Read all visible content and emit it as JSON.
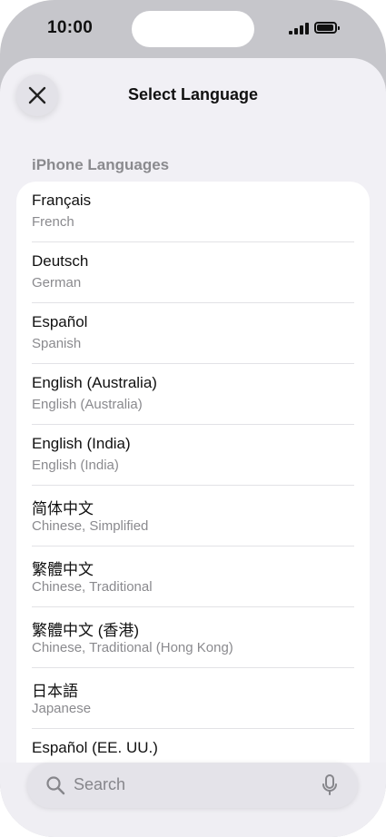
{
  "status_bar": {
    "time": "10:00"
  },
  "sheet": {
    "title": "Select Language",
    "close_icon": "close-icon"
  },
  "section": {
    "header": "iPhone Languages"
  },
  "languages": [
    {
      "name": "Français",
      "translation": "French"
    },
    {
      "name": "Deutsch",
      "translation": "German"
    },
    {
      "name": "Español",
      "translation": "Spanish"
    },
    {
      "name": "English (Australia)",
      "translation": "English (Australia)"
    },
    {
      "name": "English (India)",
      "translation": "English (India)"
    },
    {
      "name": "简体中文",
      "translation": "Chinese, Simplified"
    },
    {
      "name": "繁體中文",
      "translation": "Chinese, Traditional"
    },
    {
      "name": "繁體中文 (香港)",
      "translation": "Chinese, Traditional (Hong Kong)"
    },
    {
      "name": "日本語",
      "translation": "Japanese"
    },
    {
      "name": "Español (EE. UU.)",
      "translation": ""
    }
  ],
  "search": {
    "placeholder": "Search",
    "icons": [
      "search-icon",
      "microphone-icon"
    ]
  },
  "colors": {
    "background": "#c6c6cb",
    "sheet": "#f1f0f5",
    "card": "#ffffff",
    "secondary_text": "#8a8a8e"
  }
}
